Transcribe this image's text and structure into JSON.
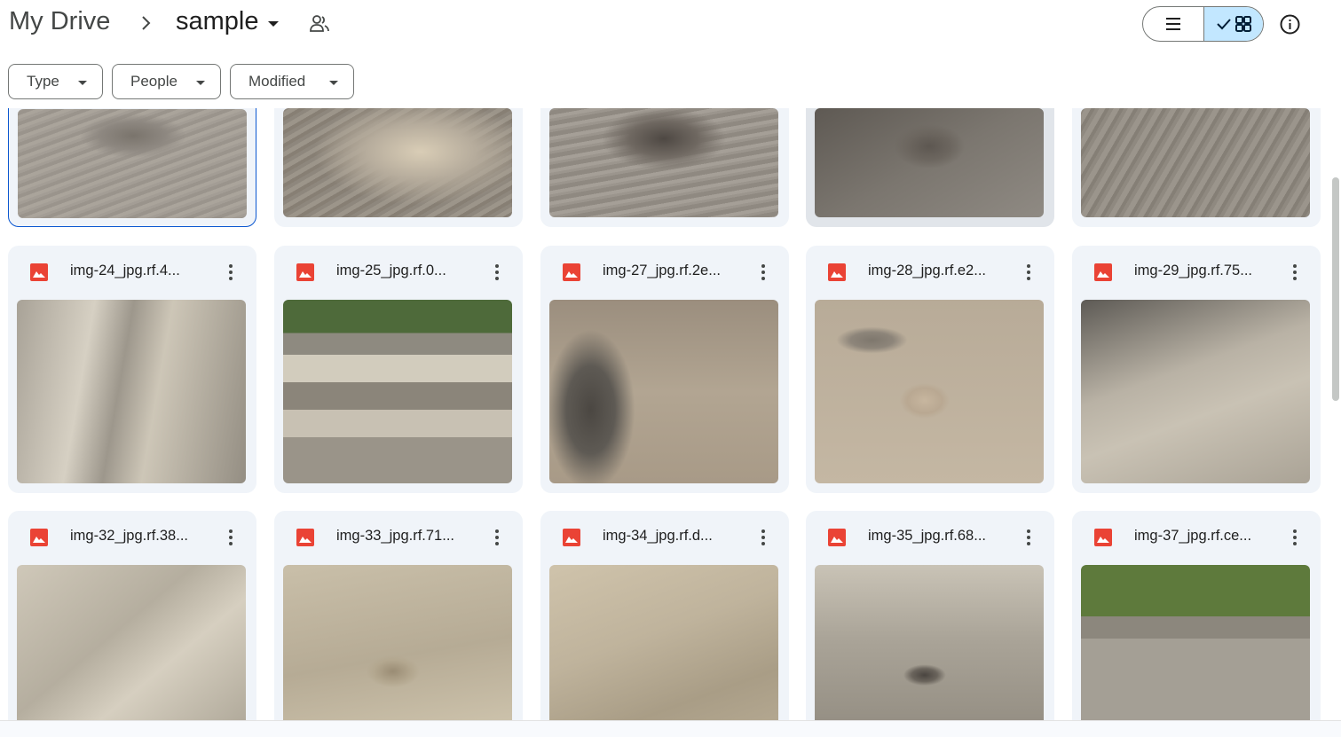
{
  "breadcrumb": {
    "root": "My Drive",
    "current": "sample"
  },
  "icons": {
    "chevron": "chevron-right-icon",
    "shared": "people-icon",
    "list": "list-view-icon",
    "grid": "grid-view-icon",
    "check": "check-icon",
    "info": "info-icon",
    "file": "image-file-icon",
    "more": "more-vert-icon"
  },
  "view": {
    "selected": "grid"
  },
  "filters": {
    "type": "Type",
    "people": "People",
    "modified": "Modified"
  },
  "colors": {
    "accent": "#0b57d0",
    "toggle_active": "#c2e7ff",
    "image_icon": "#ea4335",
    "card_bg": "#f0f4f9"
  },
  "files": {
    "row2": [
      {
        "name": "img-24_jpg.rf.4..."
      },
      {
        "name": "img-25_jpg.rf.0..."
      },
      {
        "name": "img-27_jpg.rf.2e..."
      },
      {
        "name": "img-28_jpg.rf.e2..."
      },
      {
        "name": "img-29_jpg.rf.75..."
      }
    ],
    "row3": [
      {
        "name": "img-32_jpg.rf.38..."
      },
      {
        "name": "img-33_jpg.rf.71..."
      },
      {
        "name": "img-34_jpg.rf.d..."
      },
      {
        "name": "img-35_jpg.rf.68..."
      },
      {
        "name": "img-37_jpg.rf.ce..."
      }
    ]
  }
}
